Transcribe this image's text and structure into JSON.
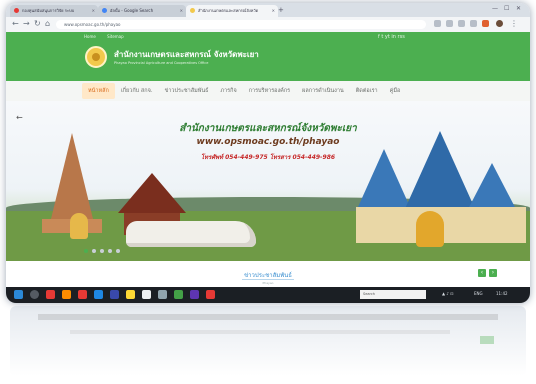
{
  "browser": {
    "tabs": [
      {
        "label": "กองทุนสนับสนุนการวิจัย ระบบ",
        "color": "#e53935"
      },
      {
        "label": "อัลบั้ม - Google Search",
        "color": "#4285f4"
      },
      {
        "label": "สำนักงานเกษตรและสหกรณ์จังหวัด",
        "color": "#f2c94c"
      }
    ],
    "new_tab": "+",
    "url": "www.opsmoac.go.th/phayao"
  },
  "site": {
    "top_links": [
      "Home",
      "Sitemap"
    ],
    "social": "f  t  yt  in  rss",
    "title": "สำนักงานเกษตรและสหกรณ์ จังหวัดพะเยา",
    "subtitle": "Phayao Provincial Agriculture and Cooperatives Office"
  },
  "menu": [
    "หน้าหลัก",
    "เกี่ยวกับ สกจ.",
    "ข่าวประชาสัมพันธ์",
    "ภารกิจ",
    "การบริหารองค์กร",
    "ผลการดำเนินงาน",
    "ติดต่อเรา",
    "คู่มือ"
  ],
  "banner": {
    "line1": "สำนักงานเกษตรและสหกรณ์จังหวัดพะเยา",
    "line2": "www.opsmoac.go.th/phayao",
    "line3": "โทรศัพท์ 054-449-975 โทรสาร 054-449-986",
    "colors": {
      "line1": "#2e7d32",
      "line2": "#6d3b1f",
      "line3": "#c62828"
    }
  },
  "section": {
    "title": "ข่าวประชาสัมพันธ์",
    "subtitle": "Phayao",
    "prev": "‹",
    "next": "›"
  },
  "taskbar": {
    "search_placeholder": "Search",
    "time": "11:42",
    "lang": "ENG"
  },
  "colors": {
    "header": "#4caf50",
    "accent": "#d86a1a"
  }
}
